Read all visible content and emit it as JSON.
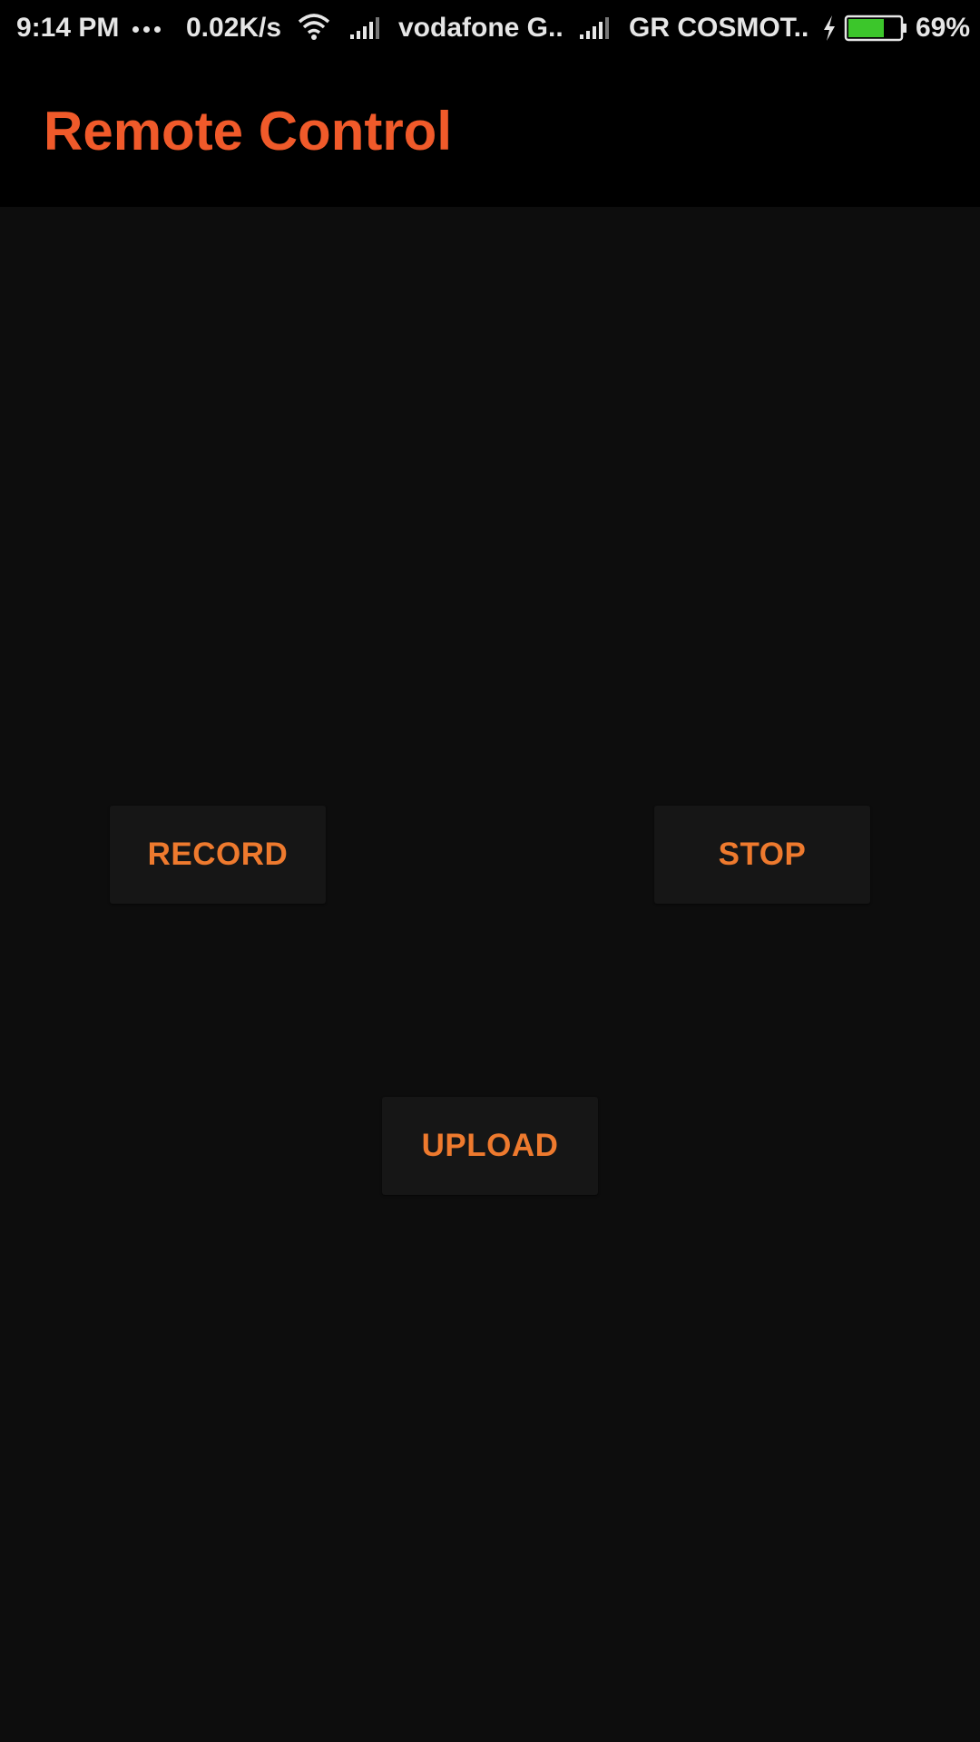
{
  "status_bar": {
    "time": "9:14 PM",
    "more_indicator": "more-notifications-icon",
    "net_speed": "0.02K/s",
    "wifi_icon": "wifi-icon",
    "signal_icon": "cell-signal-icon",
    "carrier_1": "vodafone G..",
    "carrier_2": "GR COSMOT..",
    "charging_icon": "charging-bolt-icon",
    "battery_icon": "battery-icon",
    "battery_level": 0.69,
    "battery_percent": "69%",
    "battery_color": "#3cc62b"
  },
  "app_bar": {
    "title": "Remote Control",
    "title_color": "#f05a2a"
  },
  "buttons": {
    "record_label": "RECORD",
    "stop_label": "STOP",
    "upload_label": "UPLOAD",
    "label_color": "#ee7a2e"
  }
}
